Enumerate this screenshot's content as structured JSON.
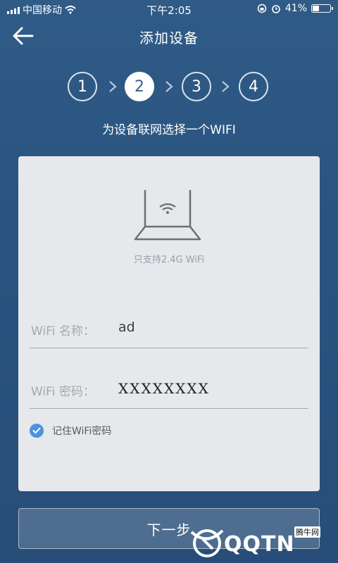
{
  "status_bar": {
    "carrier": "中国移动",
    "time": "下午2:05",
    "battery_text": "41%",
    "battery_level": 0.41
  },
  "nav": {
    "title": "添加设备"
  },
  "stepper": {
    "steps": [
      "1",
      "2",
      "3",
      "4"
    ],
    "active_index": 1,
    "active_color": "#3c5f88"
  },
  "subtitle": "为设备联网选择一个WIFI",
  "card": {
    "support_note": "只支持2.4G WiFi",
    "wifi_name_label": "WiFi 名称：",
    "wifi_name_value": "ad",
    "wifi_password_label": "WiFi 密码：",
    "wifi_password_value": "XXXXXXXX",
    "remember_label": "记住WiFi密码",
    "remember_checked": true,
    "check_color": "#4a93df"
  },
  "next_button": {
    "label": "下一步"
  },
  "watermark": {
    "brand": "QQTN",
    "tag": "腾牛网"
  },
  "icons": [
    "signal-icon",
    "wifi-icon",
    "back-arrow-icon",
    "chevron-right-icon",
    "router-icon",
    "check-icon",
    "alarm-icon",
    "lock-rotation-icon"
  ]
}
